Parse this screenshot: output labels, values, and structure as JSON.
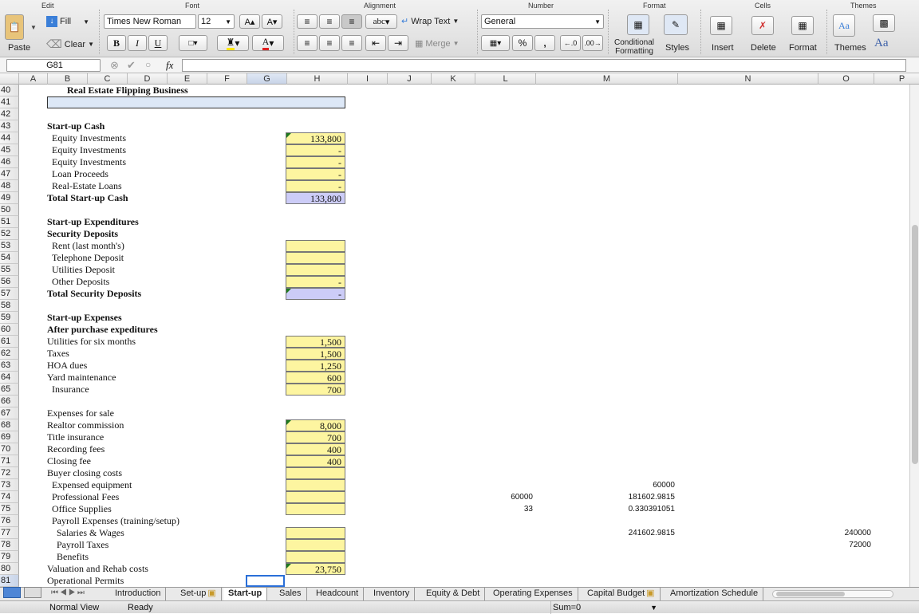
{
  "ribbon": {
    "groups": [
      "Edit",
      "Font",
      "Alignment",
      "Number",
      "Format",
      "Cells",
      "Themes"
    ],
    "paste": "Paste",
    "fill": "Fill",
    "clear": "Clear",
    "font_name": "Times New Roman",
    "font_size": "12",
    "bold": "B",
    "italic": "I",
    "underline": "U",
    "wrap_text": "Wrap Text",
    "merge": "Merge",
    "abc": "abc",
    "number_format": "General",
    "percent": "%",
    "comma": ",",
    "conditional": "Conditional Formatting",
    "styles": "Styles",
    "insert": "Insert",
    "delete": "Delete",
    "format": "Format",
    "themes": "Themes",
    "aa": "Aa"
  },
  "formula_bar": {
    "name_box": "G81",
    "fx": "fx",
    "value": ""
  },
  "columns": [
    "A",
    "B",
    "C",
    "D",
    "E",
    "F",
    "G",
    "H",
    "I",
    "J",
    "K",
    "L",
    "M",
    "N",
    "O",
    "P"
  ],
  "rows": [
    "40",
    "41",
    "42",
    "43",
    "44",
    "45",
    "46",
    "47",
    "48",
    "49",
    "50",
    "51",
    "52",
    "53",
    "54",
    "55",
    "56",
    "57",
    "58",
    "59",
    "60",
    "61",
    "62",
    "63",
    "64",
    "65",
    "66",
    "67",
    "68",
    "69",
    "70",
    "71",
    "72",
    "73",
    "74",
    "75",
    "76",
    "77",
    "78",
    "79",
    "80",
    "81"
  ],
  "sheet": {
    "title": "Real Estate Flipping Business",
    "labels": [
      {
        "r": 3,
        "t": "Start-up Cash",
        "b": true,
        "i": 0
      },
      {
        "r": 4,
        "t": "Equity Investments",
        "b": false,
        "i": 1
      },
      {
        "r": 5,
        "t": "Equity Investments",
        "b": false,
        "i": 1
      },
      {
        "r": 6,
        "t": "Equity Investments",
        "b": false,
        "i": 1
      },
      {
        "r": 7,
        "t": "Loan Proceeds",
        "b": false,
        "i": 1
      },
      {
        "r": 8,
        "t": "Real-Estate Loans",
        "b": false,
        "i": 1
      },
      {
        "r": 9,
        "t": "Total Start-up Cash",
        "b": true,
        "i": 0
      },
      {
        "r": 11,
        "t": "Start-up Expenditures",
        "b": true,
        "i": 0
      },
      {
        "r": 12,
        "t": "Security Deposits",
        "b": true,
        "i": 0
      },
      {
        "r": 13,
        "t": "Rent (last month's)",
        "b": false,
        "i": 1
      },
      {
        "r": 14,
        "t": "Telephone Deposit",
        "b": false,
        "i": 1
      },
      {
        "r": 15,
        "t": "Utilities Deposit",
        "b": false,
        "i": 1
      },
      {
        "r": 16,
        "t": "Other Deposits",
        "b": false,
        "i": 1
      },
      {
        "r": 17,
        "t": "Total Security Deposits",
        "b": true,
        "i": 0
      },
      {
        "r": 19,
        "t": "Start-up Expenses",
        "b": true,
        "i": 0
      },
      {
        "r": 20,
        "t": "After purchase expeditures",
        "b": true,
        "i": 0
      },
      {
        "r": 21,
        "t": "Utilities for six months",
        "b": false,
        "i": 0
      },
      {
        "r": 22,
        "t": "Taxes",
        "b": false,
        "i": 0
      },
      {
        "r": 23,
        "t": "HOA dues",
        "b": false,
        "i": 0
      },
      {
        "r": 24,
        "t": "Yard maintenance",
        "b": false,
        "i": 0
      },
      {
        "r": 25,
        "t": "Insurance",
        "b": false,
        "i": 1
      },
      {
        "r": 27,
        "t": "Expenses for sale",
        "b": false,
        "i": 0
      },
      {
        "r": 28,
        "t": "Realtor commission",
        "b": false,
        "i": 0
      },
      {
        "r": 29,
        "t": "Title insurance",
        "b": false,
        "i": 0
      },
      {
        "r": 30,
        "t": "Recording fees",
        "b": false,
        "i": 0
      },
      {
        "r": 31,
        "t": "Closing fee",
        "b": false,
        "i": 0
      },
      {
        "r": 32,
        "t": "Buyer closing costs",
        "b": false,
        "i": 0
      },
      {
        "r": 33,
        "t": "Expensed equipment",
        "b": false,
        "i": 1
      },
      {
        "r": 34,
        "t": "Professional Fees",
        "b": false,
        "i": 1
      },
      {
        "r": 35,
        "t": "Office Supplies",
        "b": false,
        "i": 1
      },
      {
        "r": 36,
        "t": "Payroll Expenses (training/setup)",
        "b": false,
        "i": 1
      },
      {
        "r": 37,
        "t": "Salaries & Wages",
        "b": false,
        "i": 2
      },
      {
        "r": 38,
        "t": "Payroll Taxes",
        "b": false,
        "i": 2
      },
      {
        "r": 39,
        "t": "Benefits",
        "b": false,
        "i": 2
      },
      {
        "r": 40,
        "t": "Valuation and Rehab costs",
        "b": false,
        "i": 0
      },
      {
        "r": 41,
        "t": "Operational Permits",
        "b": false,
        "i": 0
      }
    ],
    "hcells": [
      {
        "r": 4,
        "v": "133,800",
        "c": "y",
        "g": true
      },
      {
        "r": 5,
        "v": "-",
        "c": "y",
        "g": false
      },
      {
        "r": 6,
        "v": "-",
        "c": "y",
        "g": false
      },
      {
        "r": 7,
        "v": "-",
        "c": "y",
        "g": false
      },
      {
        "r": 8,
        "v": "-",
        "c": "y",
        "g": false
      },
      {
        "r": 9,
        "v": "133,800",
        "c": "b",
        "g": false
      },
      {
        "r": 13,
        "v": "",
        "c": "y",
        "g": false
      },
      {
        "r": 14,
        "v": "",
        "c": "y",
        "g": false
      },
      {
        "r": 15,
        "v": "",
        "c": "y",
        "g": false
      },
      {
        "r": 16,
        "v": "-",
        "c": "y",
        "g": false
      },
      {
        "r": 17,
        "v": "-",
        "c": "b",
        "g": true
      },
      {
        "r": 21,
        "v": "1,500",
        "c": "y",
        "g": false
      },
      {
        "r": 22,
        "v": "1,500",
        "c": "y",
        "g": false
      },
      {
        "r": 23,
        "v": "1,250",
        "c": "y",
        "g": false
      },
      {
        "r": 24,
        "v": "600",
        "c": "y",
        "g": false
      },
      {
        "r": 25,
        "v": "700",
        "c": "y",
        "g": false
      },
      {
        "r": 28,
        "v": "8,000",
        "c": "y",
        "g": true
      },
      {
        "r": 29,
        "v": "700",
        "c": "y",
        "g": false
      },
      {
        "r": 30,
        "v": "400",
        "c": "y",
        "g": false
      },
      {
        "r": 31,
        "v": "400",
        "c": "y",
        "g": false
      },
      {
        "r": 32,
        "v": "",
        "c": "y",
        "g": false
      },
      {
        "r": 33,
        "v": "",
        "c": "y",
        "g": false
      },
      {
        "r": 34,
        "v": "",
        "c": "y",
        "g": false
      },
      {
        "r": 35,
        "v": "",
        "c": "y",
        "g": false
      },
      {
        "r": 37,
        "v": "",
        "c": "y",
        "g": false
      },
      {
        "r": 38,
        "v": "",
        "c": "y",
        "g": false
      },
      {
        "r": 39,
        "v": "",
        "c": "y",
        "g": false
      },
      {
        "r": 40,
        "v": "23,750",
        "c": "y",
        "g": true
      }
    ],
    "extras": [
      {
        "r": 33,
        "col": "M",
        "v": "60000"
      },
      {
        "r": 34,
        "col": "L",
        "v": "60000"
      },
      {
        "r": 34,
        "col": "M",
        "v": "181602.9815"
      },
      {
        "r": 35,
        "col": "L",
        "v": "33"
      },
      {
        "r": 35,
        "col": "M",
        "v": "0.330391051"
      },
      {
        "r": 37,
        "col": "M",
        "v": "241602.9815"
      },
      {
        "r": 37,
        "col": "O",
        "v": "240000"
      },
      {
        "r": 38,
        "col": "O",
        "v": "72000"
      }
    ]
  },
  "tabs": [
    {
      "label": "Introduction",
      "active": false,
      "lock": false
    },
    {
      "label": "Set-up",
      "active": false,
      "lock": true
    },
    {
      "label": "Start-up",
      "active": true,
      "lock": false
    },
    {
      "label": "Sales",
      "active": false,
      "lock": false
    },
    {
      "label": "Headcount",
      "active": false,
      "lock": false
    },
    {
      "label": "Inventory",
      "active": false,
      "lock": false
    },
    {
      "label": "Equity & Debt",
      "active": false,
      "lock": false
    },
    {
      "label": "Operating Expenses",
      "active": false,
      "lock": false
    },
    {
      "label": "Capital Budget",
      "active": false,
      "lock": true
    },
    {
      "label": "Amortization Schedule",
      "active": false,
      "lock": false
    }
  ],
  "status": {
    "view": "Normal View",
    "mode": "Ready",
    "sum": "Sum=0"
  }
}
